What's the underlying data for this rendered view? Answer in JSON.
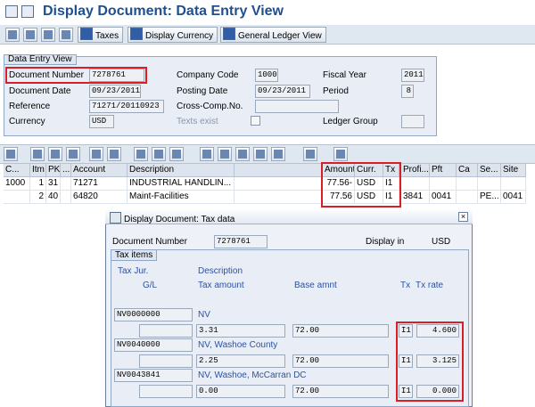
{
  "window": {
    "title": "Display Document: Data Entry View"
  },
  "toolbar": {
    "taxes_label": "Taxes",
    "display_currency_label": "Display Currency",
    "gl_view_label": "General Ledger View"
  },
  "header": {
    "group_title": "Data Entry View",
    "document_number": {
      "label": "Document Number",
      "value": "7278761"
    },
    "company_code": {
      "label": "Company Code",
      "value": "1000"
    },
    "fiscal_year": {
      "label": "Fiscal Year",
      "value": "2011"
    },
    "document_date": {
      "label": "Document Date",
      "value": "09/23/2011"
    },
    "posting_date": {
      "label": "Posting Date",
      "value": "09/23/2011"
    },
    "period": {
      "label": "Period",
      "value": "8"
    },
    "reference": {
      "label": "Reference",
      "value": "71271/20110923"
    },
    "cross_comp": {
      "label": "Cross-Comp.No.",
      "value": ""
    },
    "currency": {
      "label": "Currency",
      "value": "USD"
    },
    "texts_exist": {
      "label": "Texts exist"
    },
    "ledger_group": {
      "label": "Ledger Group",
      "value": ""
    }
  },
  "table": {
    "columns": [
      "C...",
      "Itm",
      "PK",
      "...",
      "Account",
      "Description",
      "Amount",
      "Curr.",
      "Tx",
      "Profi...",
      "Pft",
      "Ca",
      "Se...",
      "Site"
    ],
    "rows": [
      [
        "1000",
        "1",
        "31",
        "",
        "71271",
        "INDUSTRIAL HANDLIN...",
        "77.56-",
        "USD",
        "I1",
        "",
        "",
        "",
        "",
        ""
      ],
      [
        "",
        "2",
        "40",
        "",
        "64820",
        "Maint-Facilities",
        "77.56",
        "USD",
        "I1",
        "3841",
        "0041",
        "",
        "PE...",
        "0041"
      ]
    ]
  },
  "tax_dialog": {
    "title": "Display Document: Tax data",
    "doc_number_label": "Document Number",
    "doc_number_value": "7278761",
    "display_in_label": "Display in",
    "display_in_value": "USD",
    "group_title": "Tax items",
    "headers": {
      "tax_jur": "Tax Jur.",
      "description": "Description",
      "gl": "G/L",
      "tax_amount": "Tax amount",
      "base_amnt": "Base amnt",
      "tx": "Tx",
      "tx_rate": "Tx rate"
    },
    "items": [
      {
        "jur": "NV0000000",
        "description": "NV",
        "gl": "",
        "tax_amount": "3.31",
        "base": "72.00",
        "tx": "I1",
        "rate": "4.600"
      },
      {
        "jur": "NV0040000",
        "description": "NV, Washoe County",
        "gl": "",
        "tax_amount": "2.25",
        "base": "72.00",
        "tx": "I1",
        "rate": "3.125"
      },
      {
        "jur": "NV0043841",
        "description": "NV, Washoe, McCarran DC",
        "gl": "",
        "tax_amount": "0.00",
        "base": "72.00",
        "tx": "I1",
        "rate": "0.000"
      }
    ]
  }
}
